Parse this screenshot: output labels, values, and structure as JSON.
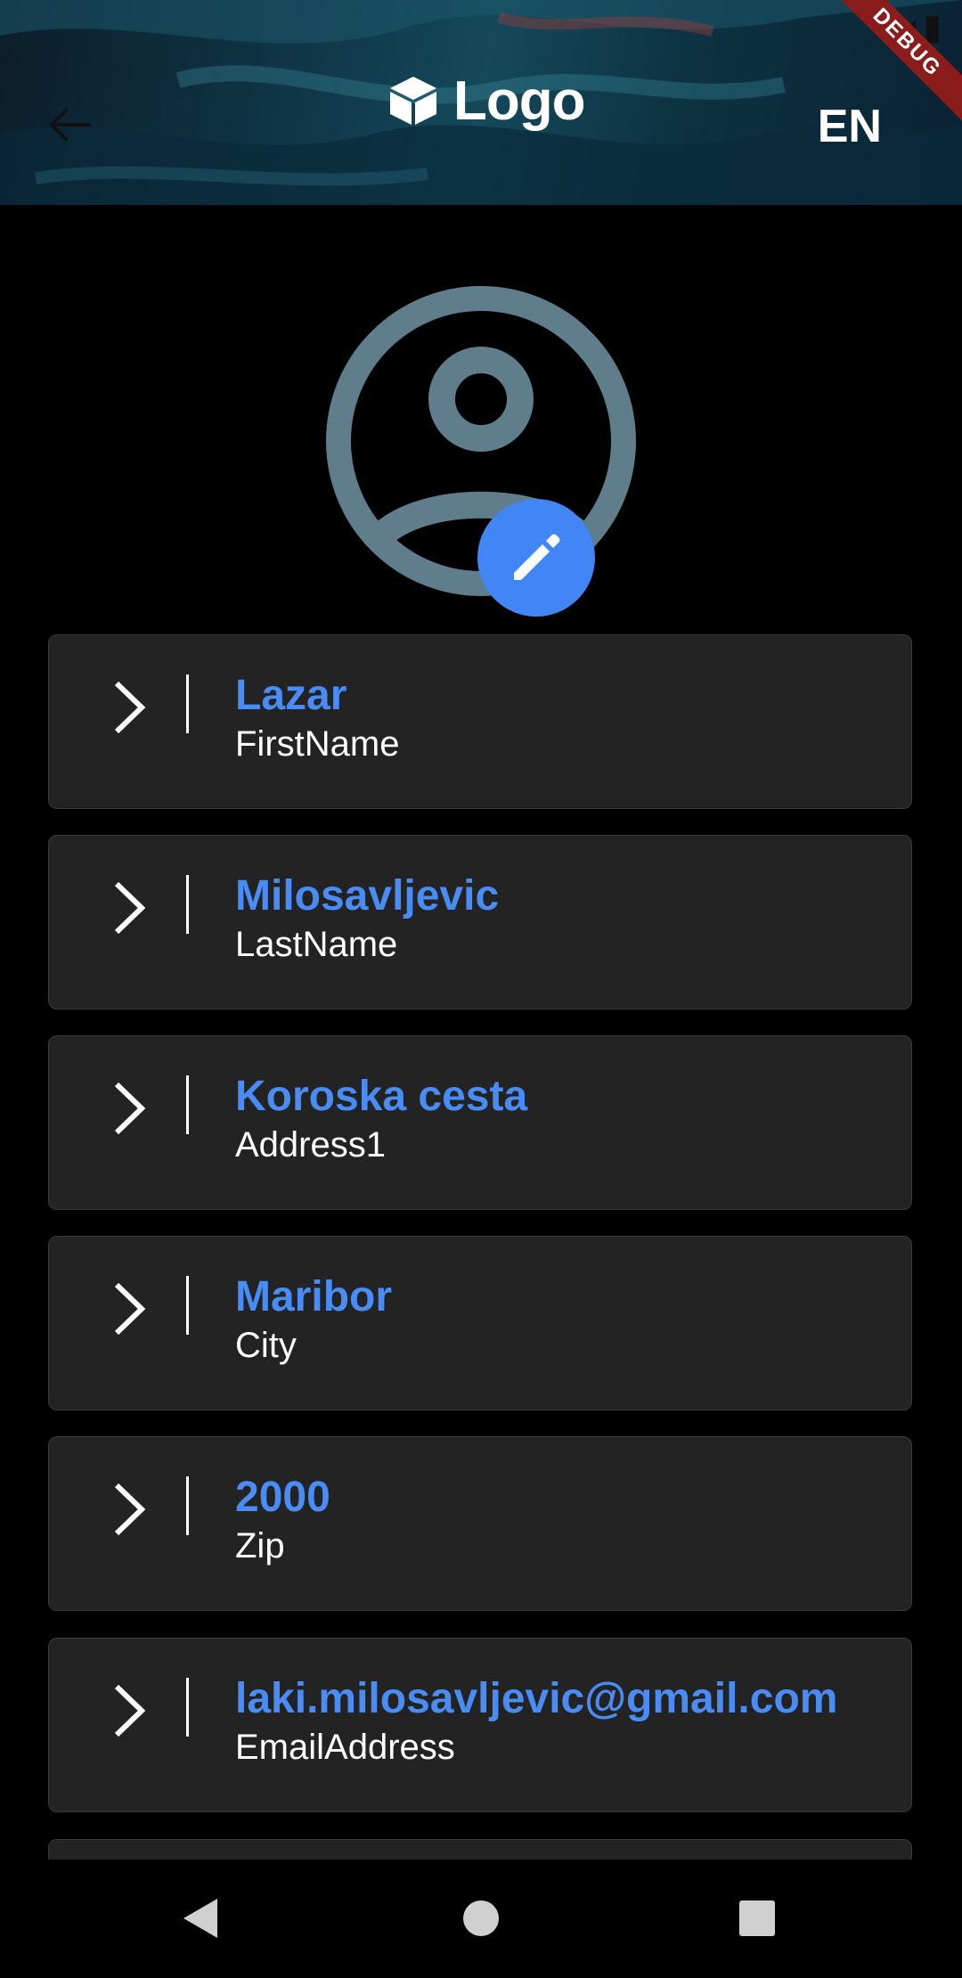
{
  "header": {
    "logo_text": "Logo",
    "language": "EN",
    "debug_banner": "DEBUG"
  },
  "profile": {
    "fields": [
      {
        "value": "Lazar",
        "label": "FirstName"
      },
      {
        "value": "Milosavljevic",
        "label": "LastName"
      },
      {
        "value": "Koroska cesta",
        "label": "Address1"
      },
      {
        "value": "Maribor",
        "label": "City"
      },
      {
        "value": "2000",
        "label": "Zip"
      },
      {
        "value": "laki.milosavljevic@gmail.com",
        "label": "EmailAddress"
      },
      {
        "value": "",
        "label": ""
      }
    ]
  },
  "colors": {
    "accent": "#4285f4",
    "value_text": "#4a8cf5",
    "card_background": "#232323",
    "avatar_icon": "#607d8b"
  },
  "icons": {
    "back": "arrow-left-icon",
    "logo": "cube-icon",
    "avatar": "account-circle-icon",
    "edit": "pencil-icon",
    "chevron": "chevron-right-icon"
  }
}
